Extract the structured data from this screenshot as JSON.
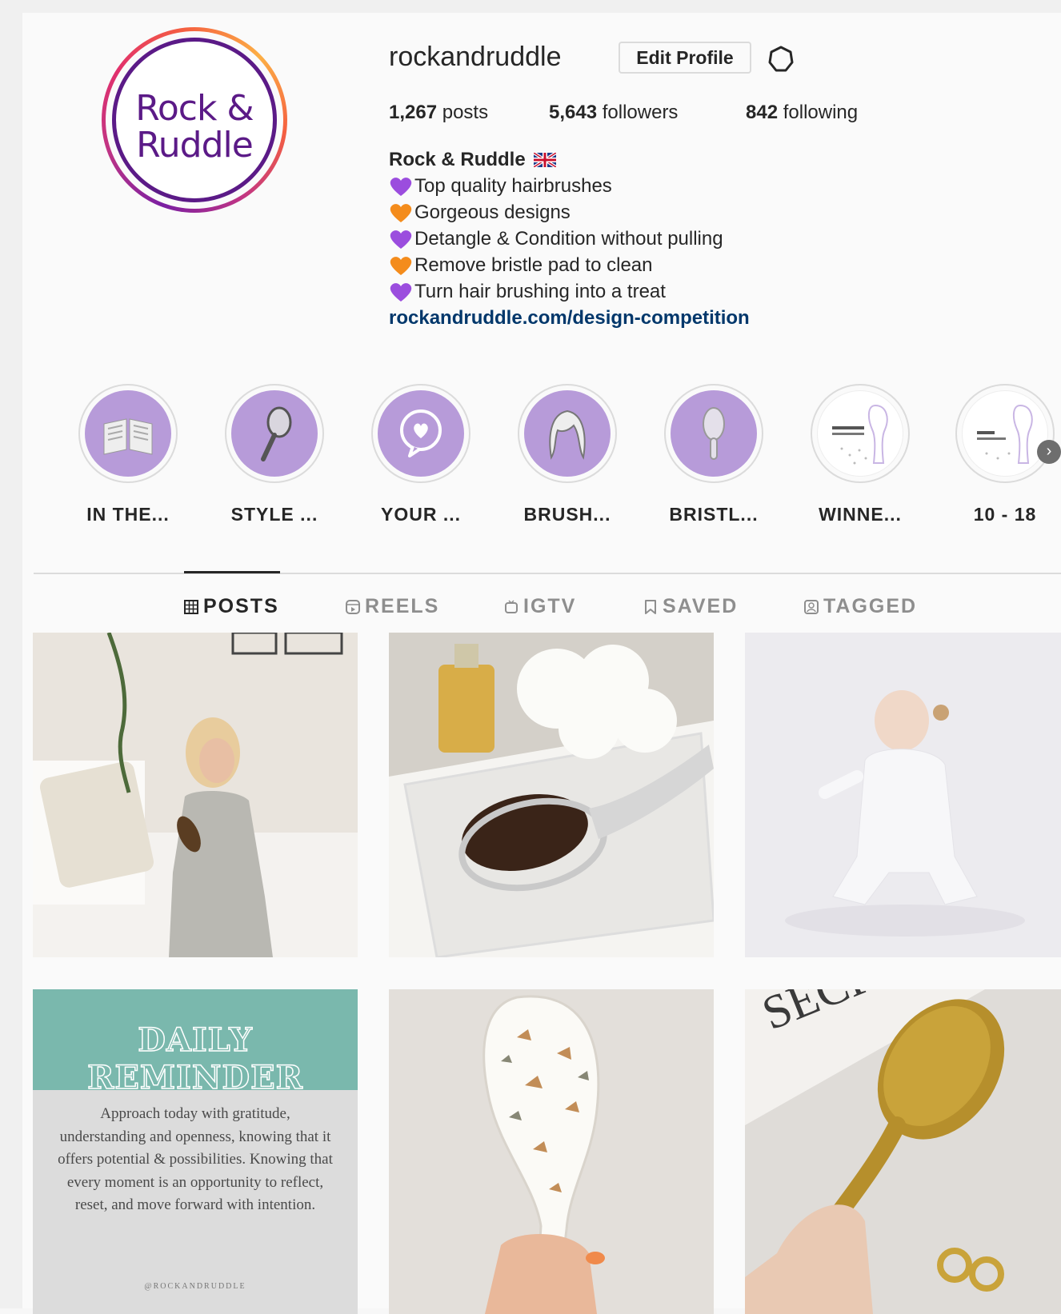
{
  "profile": {
    "username": "rockandruddle",
    "edit_button": "Edit Profile",
    "settings_icon": "gear-icon",
    "avatar_logo": [
      "Rock &",
      "Ruddle"
    ],
    "stats": {
      "posts_count": "1,267",
      "posts_label": "posts",
      "followers_count": "5,643",
      "followers_label": "followers",
      "following_count": "842",
      "following_label": "following"
    },
    "bio": {
      "name": "Rock & Ruddle",
      "lines": [
        {
          "emoji": "purple-heart",
          "text": "Top quality hairbrushes"
        },
        {
          "emoji": "orange-heart",
          "text": "Gorgeous designs"
        },
        {
          "emoji": "purple-heart",
          "text": "Detangle & Condition without pulling"
        },
        {
          "emoji": "orange-heart",
          "text": "Remove bristle pad to clean"
        },
        {
          "emoji": "purple-heart",
          "text": "Turn hair brushing into a treat"
        }
      ],
      "link": "rockandruddle.com/design-competition"
    }
  },
  "highlights": [
    {
      "label": "IN THE...",
      "icon": "newspaper-icon"
    },
    {
      "label": "STYLE ...",
      "icon": "hand-mirror-icon"
    },
    {
      "label": "YOUR ...",
      "icon": "heart-speech-bubble-icon"
    },
    {
      "label": "BRUSH...",
      "icon": "hair-icon"
    },
    {
      "label": "BRISTL...",
      "icon": "hairbrush-icon"
    },
    {
      "label": "WINNE...",
      "icon": "category-winners-icon"
    },
    {
      "label": "10 - 18",
      "icon": "age-group-icon"
    }
  ],
  "tabs": [
    {
      "label": "POSTS",
      "icon": "grid-icon",
      "active": true
    },
    {
      "label": "REELS",
      "icon": "reels-icon",
      "active": false
    },
    {
      "label": "IGTV",
      "icon": "igtv-icon",
      "active": false
    },
    {
      "label": "SAVED",
      "icon": "bookmark-icon",
      "active": false
    },
    {
      "label": "TAGGED",
      "icon": "tagged-icon",
      "active": false
    }
  ],
  "posts": {
    "reminder": {
      "title": "DAILY REMINDER",
      "body": "Approach today with gratitude, understanding and openness, knowing that it offers potential & possibilities. Knowing that every moment is an opportunity to reflect, reset, and move forward with intention.",
      "handle": "@ROCKANDRUDDLE"
    },
    "magazine_text": "SECRE the NIGHT"
  },
  "colors": {
    "accent_purple": "#5b1a87",
    "highlight_lilac": "#b79bd9",
    "link_blue": "#00376b",
    "reminder_teal": "#7ab8ad"
  }
}
